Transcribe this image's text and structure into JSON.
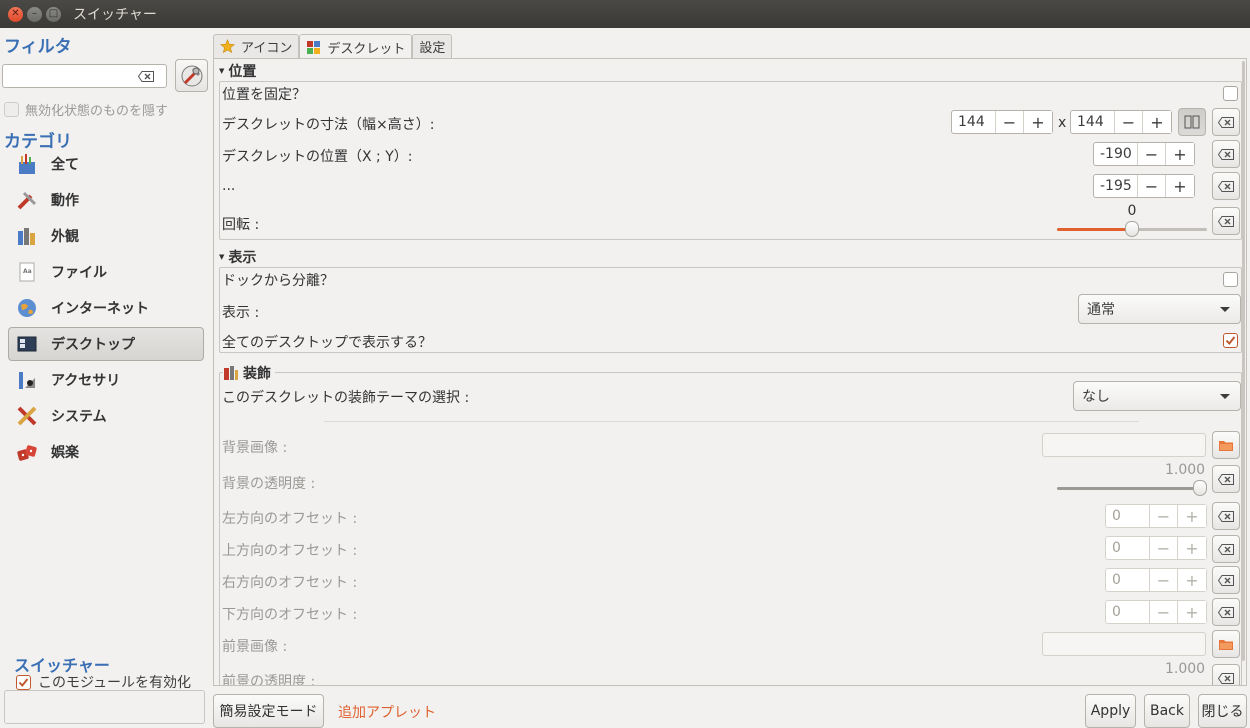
{
  "window": {
    "title": "スイッチャー"
  },
  "sidebar": {
    "filter_title": "フィルタ",
    "filter_value": "",
    "hide_disabled_label": "無効化状態のものを隠す",
    "category_title": "カテゴリ",
    "categories": [
      {
        "label": "全て",
        "icon": "all-icon"
      },
      {
        "label": "動作",
        "icon": "behavior-icon"
      },
      {
        "label": "外観",
        "icon": "appearance-icon"
      },
      {
        "label": "ファイル",
        "icon": "files-icon"
      },
      {
        "label": "インターネット",
        "icon": "internet-icon"
      },
      {
        "label": "デスクトップ",
        "icon": "desktop-icon",
        "active": true
      },
      {
        "label": "アクセサリ",
        "icon": "accessories-icon"
      },
      {
        "label": "システム",
        "icon": "system-icon"
      },
      {
        "label": "娯楽",
        "icon": "fun-icon"
      }
    ],
    "module_title": "スイッチャー",
    "module_enable_label": "このモジュールを有効化",
    "module_enabled": true
  },
  "tabs": [
    {
      "label": "アイコン",
      "icon": "star-icon"
    },
    {
      "label": "デスクレット",
      "icon": "desklet-icon",
      "active": true
    },
    {
      "label": "設定"
    }
  ],
  "position": {
    "header": "位置",
    "lock_label": "位置を固定？",
    "lock_checked": false,
    "size_label": "デスクレットの寸法（幅×高さ）:",
    "width": "144",
    "height": "144",
    "size_separator": "x",
    "pos_label": "デスクレットの位置（X ; Y）:",
    "x": "-190",
    "ellipsis_label": "...",
    "y": "-195",
    "rotation_label": "回転 :",
    "rotation_value": "0",
    "rotation_fraction": 0.5
  },
  "display": {
    "header": "表示",
    "detach_label": "ドックから分離？",
    "detach_checked": false,
    "visibility_label": "表示 :",
    "visibility_value": "通常",
    "all_desktops_label": "全てのデスクトップで表示する？",
    "all_desktops_checked": true
  },
  "decoration": {
    "header": "装飾",
    "theme_label": "このデスクレットの装飾テーマの選択 :",
    "theme_value": "なし",
    "bg_image_label": "背景画像 :",
    "bg_alpha_label": "背景の透明度 :",
    "bg_alpha_value": "1.000",
    "bg_alpha_fraction": 1.0,
    "left_offset_label": "左方向のオフセット :",
    "left_offset": "0",
    "top_offset_label": "上方向のオフセット :",
    "top_offset": "0",
    "right_offset_label": "右方向のオフセット :",
    "right_offset": "0",
    "bottom_offset_label": "下方向のオフセット :",
    "bottom_offset": "0",
    "fg_image_label": "前景画像 :",
    "fg_alpha_label": "前景の透明度 :",
    "fg_alpha_value": "1.000"
  },
  "bottom": {
    "simple_mode_label": "簡易設定モード",
    "add_applet_label": "追加アプレット",
    "apply_label": "Apply",
    "back_label": "Back",
    "close_label": "閉じる"
  },
  "colors": {
    "accent": "#e0612e",
    "section_title": "#3a6fb4",
    "titlebar": "#3f3e3a"
  }
}
